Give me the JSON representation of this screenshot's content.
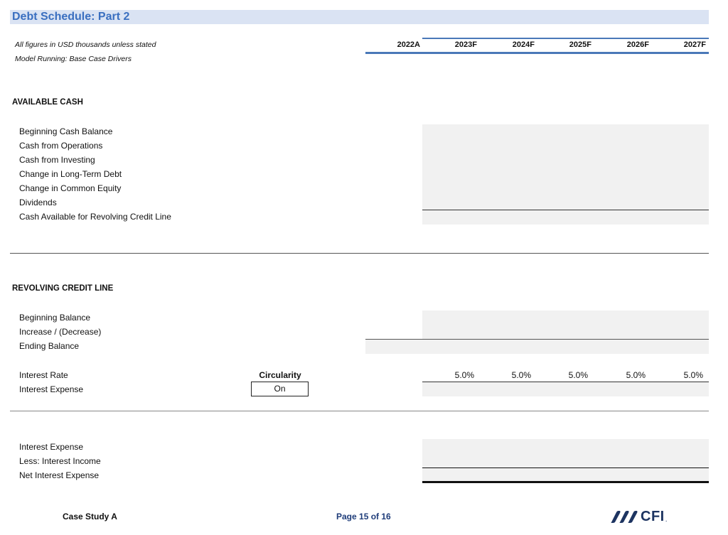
{
  "page": {
    "title": "Debt Schedule: Part 2",
    "notes": [
      "All figures in USD thousands unless stated",
      "Model Running: Base Case Drivers"
    ]
  },
  "columns": [
    "2022A",
    "2023F",
    "2024F",
    "2025F",
    "2026F",
    "2027F"
  ],
  "available_cash": {
    "title": "AVAILABLE CASH",
    "rows": [
      "Beginning Cash Balance",
      "Cash from Operations",
      "Cash from Investing",
      "Change in Long-Term Debt",
      "Change in Common Equity",
      "Dividends",
      "Cash Available for Revolving Credit Line"
    ]
  },
  "revolving_credit_line": {
    "title": "REVOLVING CREDIT LINE",
    "rows": [
      "Beginning Balance",
      "Increase / (Decrease)",
      "Ending Balance"
    ],
    "interest_rate_label": "Interest Rate",
    "interest_expense_label": "Interest Expense",
    "interest_rates": [
      "5.0%",
      "5.0%",
      "5.0%",
      "5.0%",
      "5.0%"
    ],
    "circularity": {
      "label": "Circularity",
      "value": "On"
    }
  },
  "net_interest": {
    "rows": [
      "Interest Expense",
      "Less: Interest Income",
      "Net Interest Expense"
    ]
  },
  "footer": {
    "case": "Case Study A",
    "page": "Page 15 of 16",
    "logo": "CFI",
    "logo_dot": "."
  },
  "colors": {
    "title": "#3a6fc0",
    "title_bg": "#dae3f3",
    "header_rule": "#4a78b8",
    "input_shade": "#f1f1f1",
    "logo": "#1d3461"
  }
}
